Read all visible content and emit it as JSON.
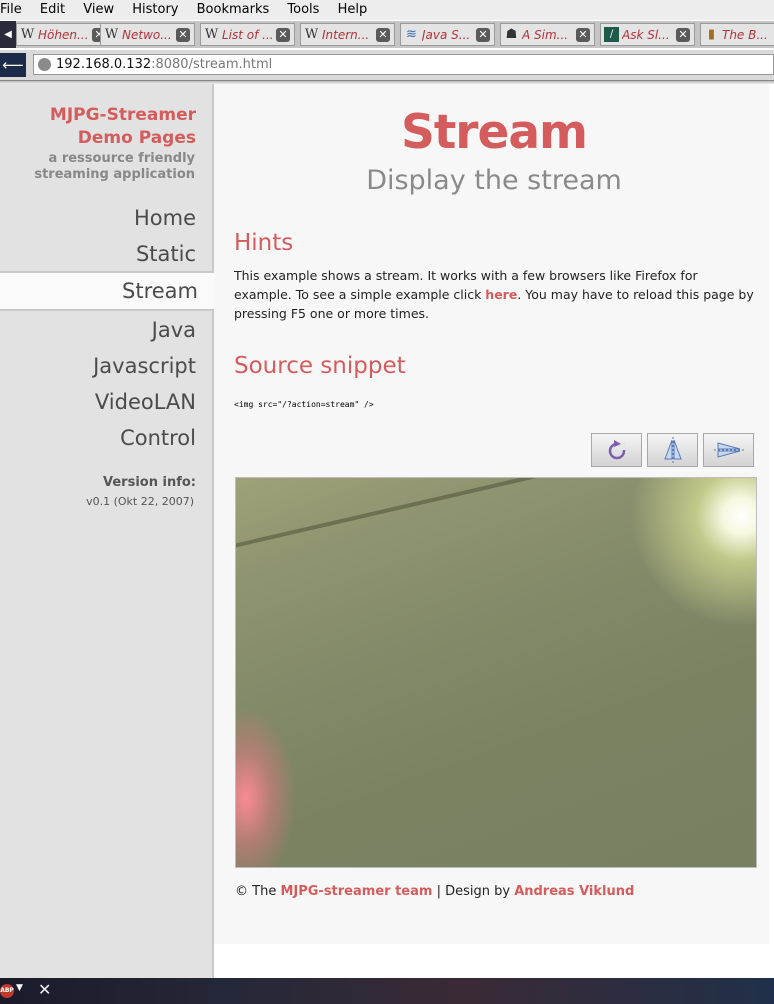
{
  "browser": {
    "menu": [
      "File",
      "Edit",
      "View",
      "History",
      "Bookmarks",
      "Tools",
      "Help"
    ],
    "tabs": [
      {
        "label": "Höhen...",
        "icon": "wikipedia-icon"
      },
      {
        "label": "Netwo...",
        "icon": "wikipedia-icon"
      },
      {
        "label": "List of ...",
        "icon": "wikipedia-icon"
      },
      {
        "label": "Intern...",
        "icon": "wikipedia-icon"
      },
      {
        "label": "Java S...",
        "icon": "java-icon"
      },
      {
        "label": "A Sim...",
        "icon": "game-icon"
      },
      {
        "label": "Ask Sl...",
        "icon": "askslashdot-icon"
      },
      {
        "label": "The B...",
        "icon": "book-icon"
      }
    ],
    "url_host": "192.168.0.132",
    "url_path": ":8080/stream.html"
  },
  "sidebar": {
    "title_line1": "MJPG-Streamer",
    "title_line2": "Demo Pages",
    "subtitle_line1": "a ressource friendly",
    "subtitle_line2": "streaming application",
    "nav": [
      "Home",
      "Static",
      "Stream",
      "Java",
      "Javascript",
      "VideoLAN",
      "Control"
    ],
    "active": "Stream",
    "version_heading": "Version info:",
    "version_value": "v0.1 (Okt 22, 2007)"
  },
  "main": {
    "title": "Stream",
    "subtitle": "Display the stream",
    "hints_heading": "Hints",
    "hints_text_1": "This example shows a stream. It works with a few browsers like Firefox for example. To see a simple example click ",
    "hints_link": "here",
    "hints_text_2": ". You may have to reload this page by pressing F5 one or more times.",
    "source_heading": "Source snippet",
    "code": "<img src=\"/?action=stream\" />",
    "footer_prefix": "© The ",
    "footer_link1": "MJPG-streamer team",
    "footer_mid": " | Design by ",
    "footer_link2": "Andreas Viklund"
  },
  "colors": {
    "accent": "#d45c5c",
    "sidebar_bg": "#e2e2e2"
  }
}
